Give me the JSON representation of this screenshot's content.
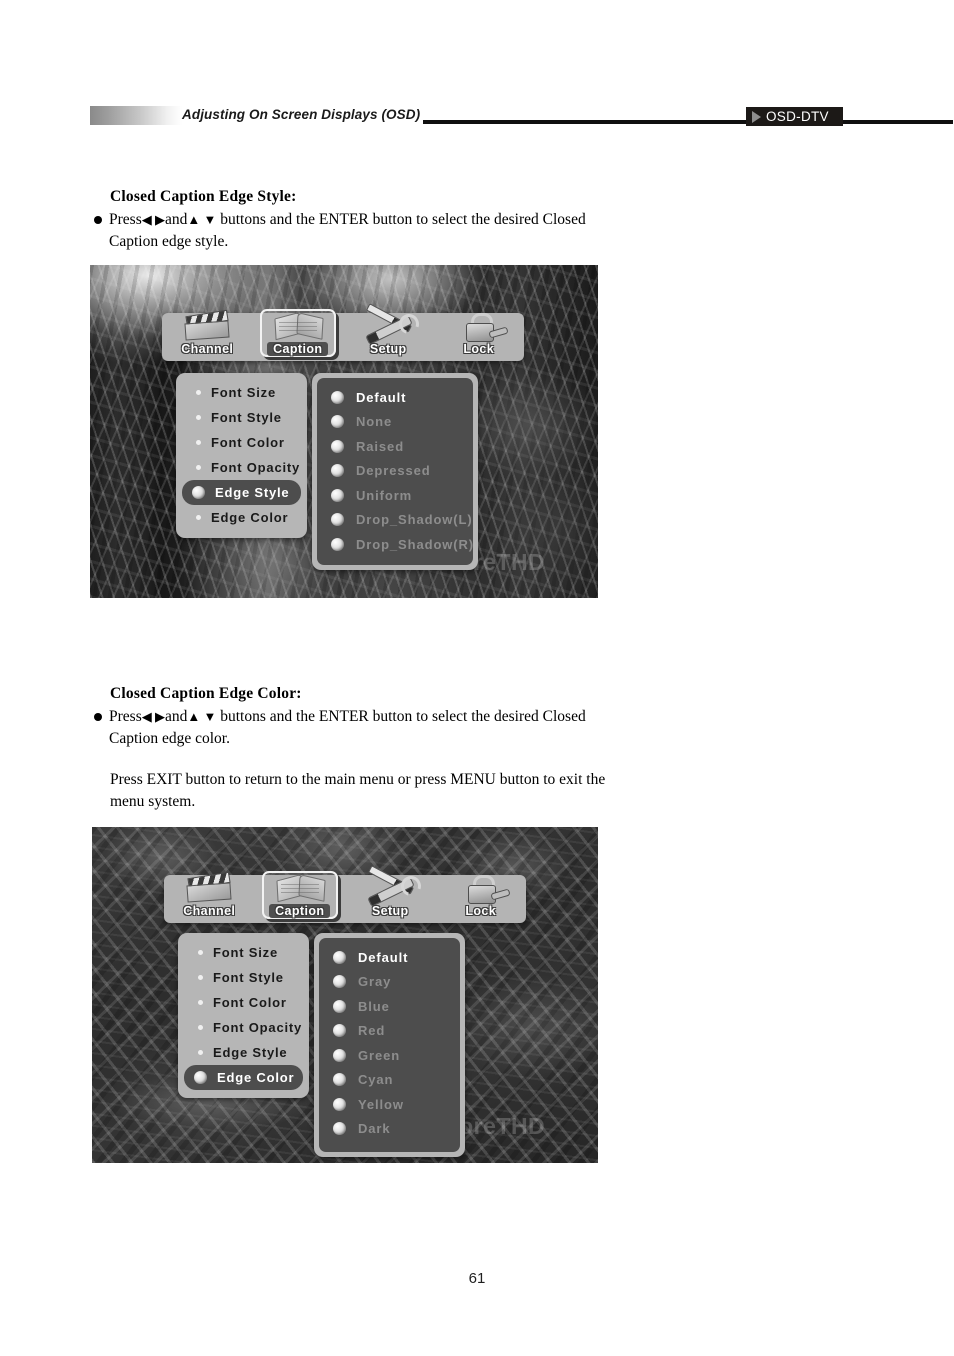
{
  "header": {
    "running_title": "Adjusting On Screen Displays (OSD)",
    "tag_label": "OSD-DTV"
  },
  "sections": [
    {
      "heading": "Closed Caption Edge Style:",
      "bullet_prefix": "Press",
      "bullet_arrows_lr": "◀ ▶",
      "bullet_mid": "and",
      "bullet_arrows_ud": "▲ ▼",
      "bullet_rest": "buttons and the ENTER button to select the desired Closed Caption edge style."
    },
    {
      "heading": "Closed Caption Edge Color:",
      "bullet_prefix": "Press",
      "bullet_arrows_lr": "◀ ▶",
      "bullet_mid": "and",
      "bullet_arrows_ud": "▲ ▼",
      "bullet_rest": "buttons and the ENTER button to select the desired Closed Caption edge color.",
      "paragraph": "Press EXIT button to return to the main menu or press MENU button to exit the menu system."
    }
  ],
  "osd": {
    "tabs": [
      {
        "label": "Channel",
        "icon": "clapperboard-icon",
        "selected": false
      },
      {
        "label": "Caption",
        "icon": "open-book-icon",
        "selected": true
      },
      {
        "label": "Setup",
        "icon": "tools-icon",
        "selected": false
      },
      {
        "label": "Lock",
        "icon": "padlock-icon",
        "selected": false
      }
    ],
    "caption_menu_items": [
      "Font  Size",
      "Font  Style",
      "Font  Color",
      "Font  Opacity",
      "Edge  Style",
      "Edge  Color"
    ],
    "edge_style_options": [
      "Default",
      "None",
      "Raised",
      "Depressed",
      "Uniform",
      "Drop_Shadow(L)",
      "Drop_Shadow(R)"
    ],
    "edge_color_options": [
      "Default",
      "Gray",
      "Blue",
      "Red",
      "Green",
      "Cyan",
      "Yellow",
      "Dark"
    ],
    "screenshot_1": {
      "active_menu_item": "Edge  Style",
      "selected_option": "Default",
      "watermark": "KoreTHD"
    },
    "screenshot_2": {
      "active_menu_item": "Edge  Color",
      "selected_option": "Default",
      "watermark": "KoreTHD"
    }
  },
  "footer": {
    "page_number": "61"
  }
}
